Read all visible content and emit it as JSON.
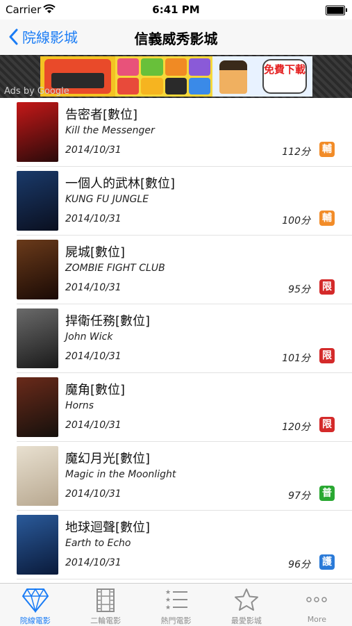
{
  "status_bar": {
    "carrier": "Carrier",
    "time": "6:41 PM"
  },
  "nav": {
    "back_label": "院線影城",
    "title": "信義威秀影城"
  },
  "ad": {
    "label": "Ads by Google",
    "bubble_text": "免費下載",
    "colors": [
      "#f3c322",
      "#e94a2a",
      "#f6d83a",
      "#e8f2ff"
    ]
  },
  "movies": [
    {
      "cn": "告密者[數位]",
      "en": "Kill the Messenger",
      "date": "2014/10/31",
      "mins": "112分",
      "rating": "輔",
      "rating_color": "#f28c28",
      "poster_colors": [
        "#c41818",
        "#2a0a0a"
      ]
    },
    {
      "cn": "一個人的武林[數位]",
      "en": "KUNG FU JUNGLE",
      "date": "2014/10/31",
      "mins": "100分",
      "rating": "輔",
      "rating_color": "#f28c28",
      "poster_colors": [
        "#1a3a6a",
        "#0a0f1f"
      ]
    },
    {
      "cn": "屍城[數位]",
      "en": "ZOMBIE FIGHT CLUB",
      "date": "2014/10/31",
      "mins": "95分",
      "rating": "限",
      "rating_color": "#d42a2a",
      "poster_colors": [
        "#6a3a1a",
        "#1a0a05"
      ]
    },
    {
      "cn": "捍衛任務[數位]",
      "en": "John Wick",
      "date": "2014/10/31",
      "mins": "101分",
      "rating": "限",
      "rating_color": "#d42a2a",
      "poster_colors": [
        "#6a6a6a",
        "#1a1a1a"
      ]
    },
    {
      "cn": "魔角[數位]",
      "en": "Horns",
      "date": "2014/10/31",
      "mins": "120分",
      "rating": "限",
      "rating_color": "#d42a2a",
      "poster_colors": [
        "#6a2a1a",
        "#15100c"
      ]
    },
    {
      "cn": "魔幻月光[數位]",
      "en": "Magic in the Moonlight",
      "date": "2014/10/31",
      "mins": "97分",
      "rating": "普",
      "rating_color": "#2aa832",
      "poster_colors": [
        "#e8e0d0",
        "#b8a890"
      ]
    },
    {
      "cn": "地球迴聲[數位]",
      "en": "Earth to Echo",
      "date": "2014/10/31",
      "mins": "96分",
      "rating": "護",
      "rating_color": "#2a7ad8",
      "poster_colors": [
        "#2a5a9a",
        "#0a1a3a"
      ]
    },
    {
      "cn": "",
      "en": "",
      "date": "",
      "mins": "",
      "rating": "",
      "rating_color": "#ffffff",
      "poster_colors": [
        "#8a6a3a",
        "#3a2a1a"
      ]
    }
  ],
  "tabs": [
    {
      "label": "院線電影",
      "icon": "diamond-icon",
      "active": true
    },
    {
      "label": "二輪電影",
      "icon": "film-strip-icon",
      "active": false
    },
    {
      "label": "熱門電影",
      "icon": "ranked-list-icon",
      "active": false
    },
    {
      "label": "最愛影城",
      "icon": "star-icon",
      "active": false
    },
    {
      "label": "More",
      "icon": "more-dots-icon",
      "active": false
    }
  ],
  "accent_color": "#1a7cf5"
}
